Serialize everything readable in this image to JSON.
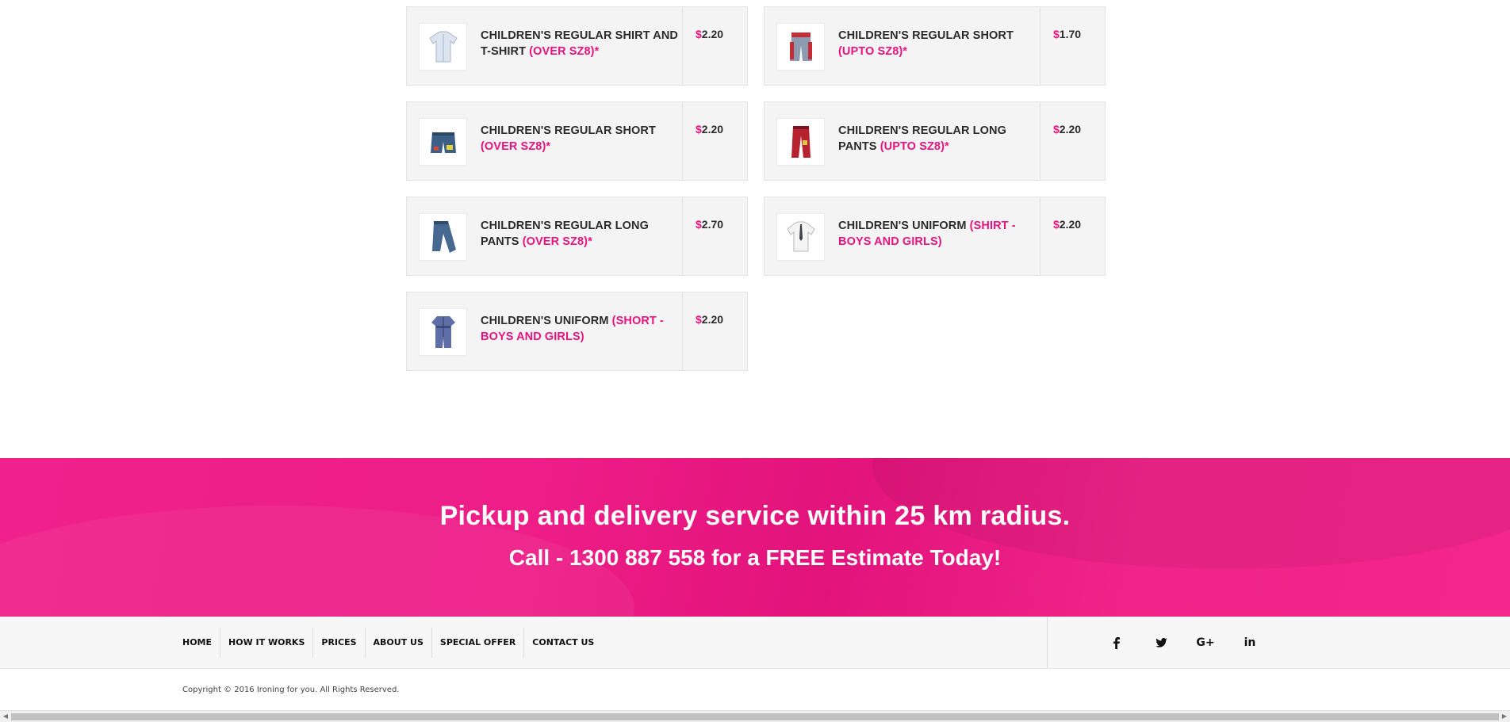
{
  "products": [
    {
      "name": "CHILDREN'S REGULAR SHIRT AND T-SHIRT",
      "note": "(OVER SZ8)*",
      "currency": "$",
      "price": "2.20",
      "icon": "shirt-icon"
    },
    {
      "name": "CHILDREN'S REGULAR SHORT",
      "note": "(UPTO SZ8)*",
      "currency": "$",
      "price": "1.70",
      "icon": "shorts-icon"
    },
    {
      "name": "CHILDREN'S REGULAR SHORT",
      "note": "(OVER SZ8)*",
      "currency": "$",
      "price": "2.20",
      "icon": "shorts-icon"
    },
    {
      "name": "CHILDREN'S REGULAR LONG PANTS",
      "note": "(UPTO SZ8)*",
      "currency": "$",
      "price": "2.20",
      "icon": "pants-icon"
    },
    {
      "name": "CHILDREN'S REGULAR LONG PANTS",
      "note": "(OVER SZ8)*",
      "currency": "$",
      "price": "2.70",
      "icon": "pants-icon"
    },
    {
      "name": "CHILDREN'S UNIFORM",
      "note": "(SHIRT - BOYS AND GIRLS)",
      "currency": "$",
      "price": "2.20",
      "icon": "uniform-shirt-icon"
    },
    {
      "name": "CHILDREN'S UNIFORM",
      "note": "(SHORT - BOYS AND GIRLS)",
      "currency": "$",
      "price": "2.20",
      "icon": "romper-icon"
    }
  ],
  "banner": {
    "line1": "Pickup and delivery service within 25 km radius.",
    "line2": "Call - 1300 887 558 for a FREE Estimate Today!"
  },
  "footer": {
    "menu": [
      "HOME",
      "HOW IT WORKS",
      "PRICES",
      "ABOUT US",
      "SPECIAL OFFER",
      "CONTACT US"
    ],
    "social": [
      {
        "icon": "facebook-icon",
        "glyph": "f"
      },
      {
        "icon": "twitter-icon",
        "glyph": "🐦"
      },
      {
        "icon": "google-plus-icon",
        "glyph": "G+"
      },
      {
        "icon": "linkedin-icon",
        "glyph": "in"
      }
    ],
    "copyright": "Copyright © 2016 Ironing for you. All Rights Reserved."
  },
  "colors": {
    "accent": "#e8137f",
    "banner": "#f0218c"
  }
}
